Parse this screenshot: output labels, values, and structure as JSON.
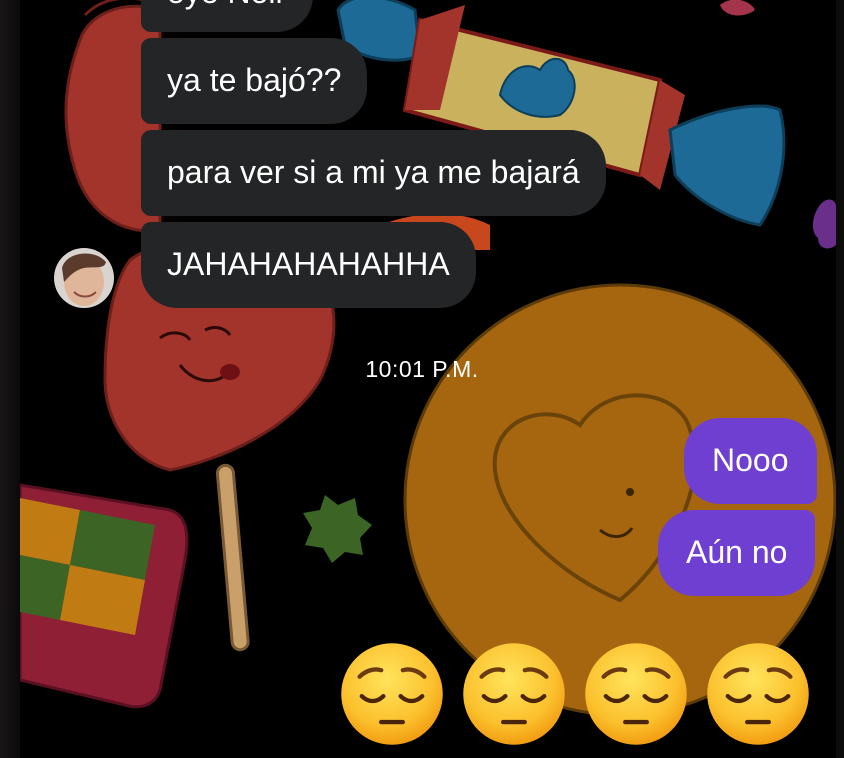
{
  "chat": {
    "messages_in": [
      {
        "text": "oye Noii"
      },
      {
        "text": "ya te bajó??"
      },
      {
        "text": "para ver si a mi ya me bajará"
      },
      {
        "text": "JAHAHAHAHAHHA"
      }
    ],
    "timestamp": "10:01 P.M.",
    "messages_out": [
      {
        "text": "Nooo"
      },
      {
        "text": "Aún no"
      }
    ],
    "emoji_reaction": {
      "icon": "pensive-face-icon",
      "count": 4
    }
  },
  "colors": {
    "incoming_bubble": "#242526",
    "outgoing_bubble": "#6e3fd0",
    "background": "#000000"
  }
}
